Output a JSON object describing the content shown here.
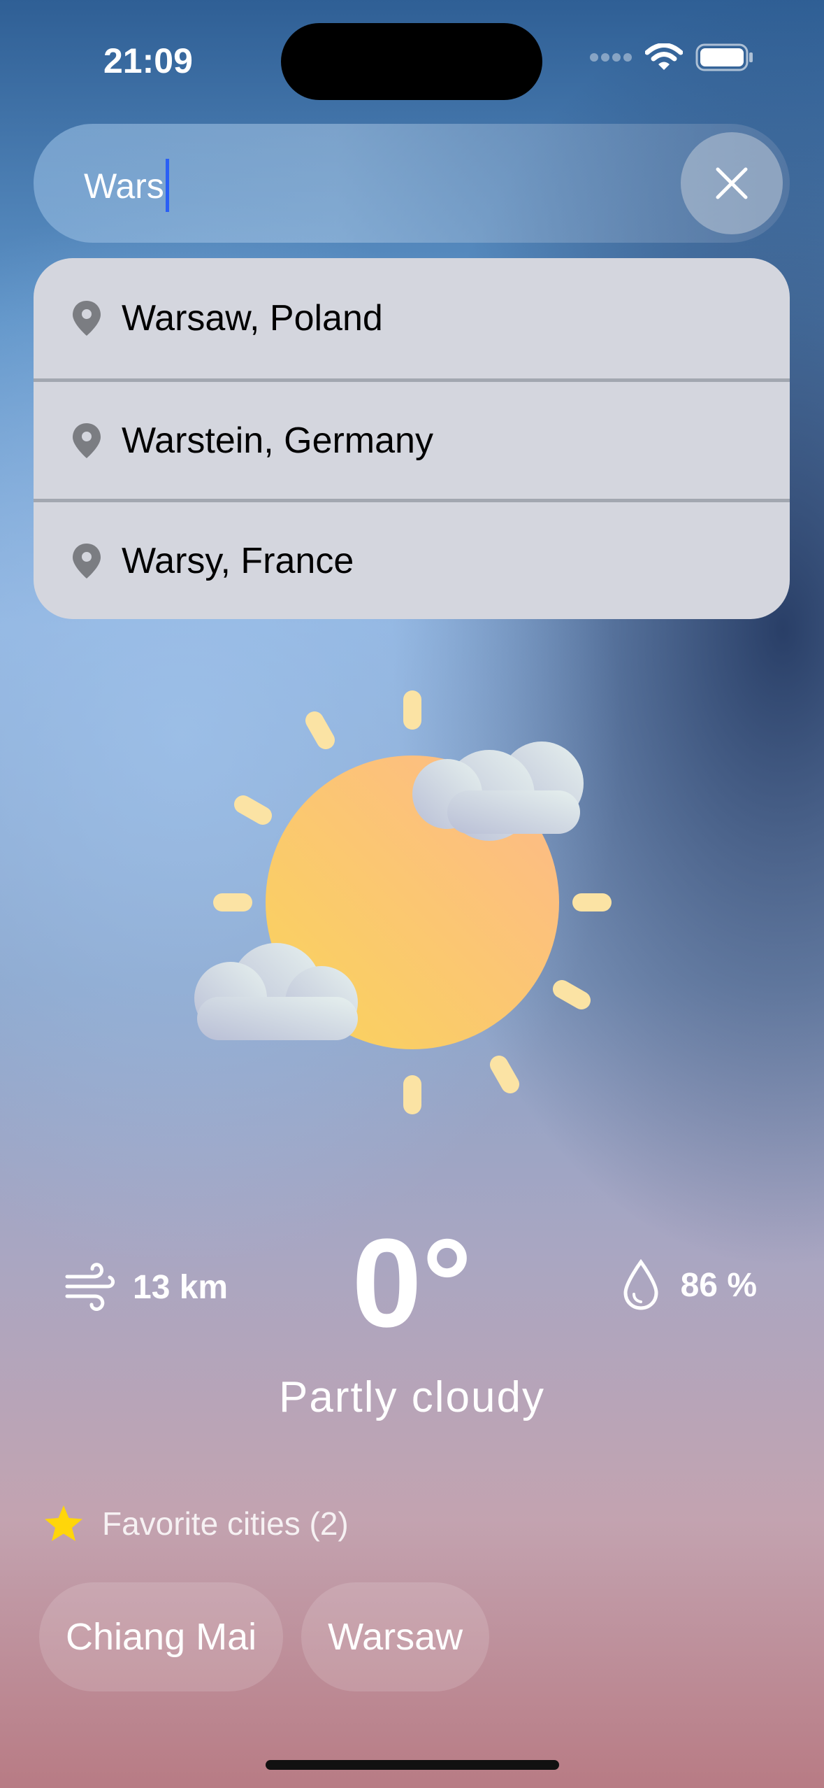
{
  "status_bar": {
    "time": "21:09"
  },
  "search": {
    "value": "Wars"
  },
  "suggestions": [
    {
      "label": "Warsaw, Poland"
    },
    {
      "label": "Warstein, Germany"
    },
    {
      "label": "Warsy, France"
    }
  ],
  "weather": {
    "wind": "13 km",
    "temperature": "0°",
    "humidity": "86 %",
    "condition": "Partly cloudy"
  },
  "favorites": {
    "title": "Favorite cities (2)",
    "cities": [
      "Chiang Mai",
      "Warsaw"
    ]
  },
  "colors": {
    "star": "#ffd60a",
    "caret": "#2a5ff5",
    "sun": "#f9c25e",
    "ray": "#fbe3a4"
  },
  "icons": [
    "signal-icon",
    "wifi-icon",
    "battery-icon",
    "close-icon",
    "location-pin-icon",
    "wind-icon",
    "drop-icon",
    "star-icon",
    "partly-cloudy-icon"
  ]
}
